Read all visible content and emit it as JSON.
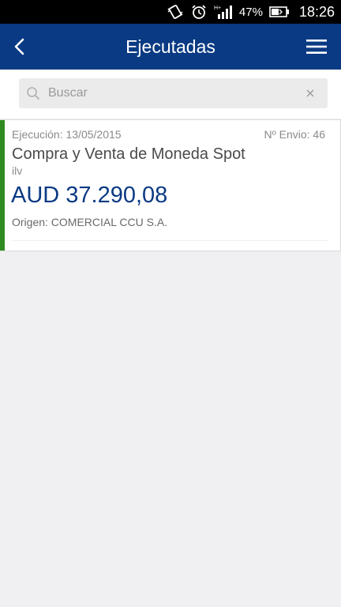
{
  "status_bar": {
    "battery_percent": "47%",
    "time": "18:26",
    "icons": [
      "vibrate-icon",
      "alarm-icon",
      "signal-icon",
      "battery-icon"
    ]
  },
  "header": {
    "title": "Ejecutadas",
    "back_icon": "chevron-left-icon",
    "menu_icon": "hamburger-menu-icon",
    "background_color": "#0a3a83"
  },
  "search": {
    "placeholder": "Buscar",
    "value": ""
  },
  "operations": [
    {
      "execution_label": "Ejecución: 13/05/2015",
      "envio_label": "Nº Envio: 46",
      "product": "Compra y Venta de Moneda Spot",
      "subtitle": "ilv",
      "amount": "AUD 37.290,08",
      "origin": "Origen: COMERCIAL CCU S.A.",
      "accent_color": "#2e8b1f"
    }
  ]
}
